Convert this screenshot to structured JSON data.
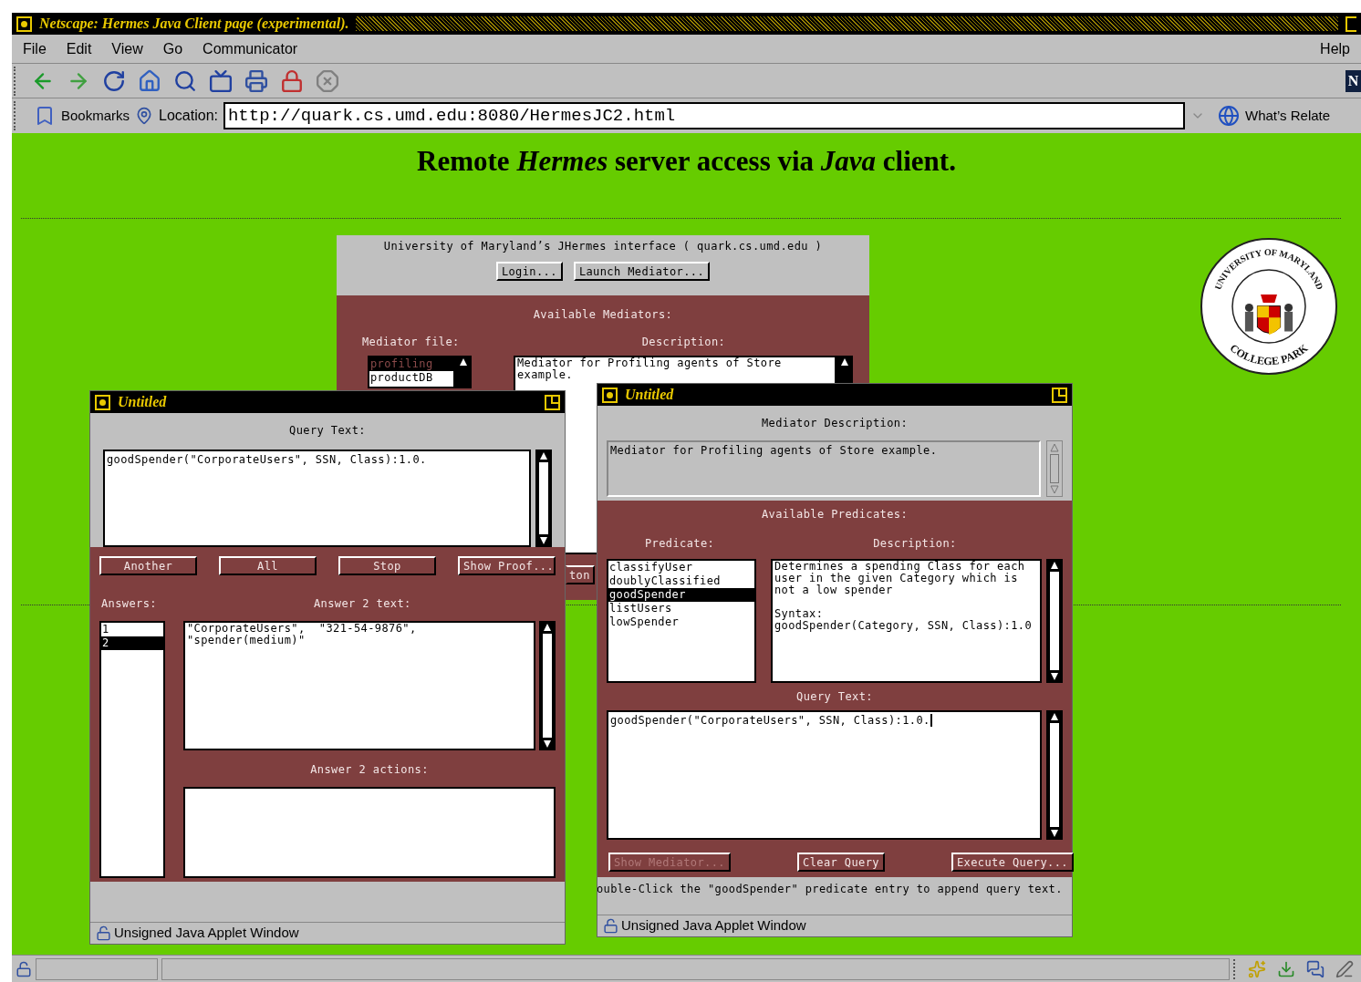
{
  "window": {
    "title": "Netscape: Hermes Java Client page (experimental)."
  },
  "menu": {
    "items": [
      "File",
      "Edit",
      "View",
      "Go",
      "Communicator"
    ],
    "help": "Help"
  },
  "location_bar": {
    "bookmarks": "Bookmarks",
    "label": "Location:",
    "url": "http://quark.cs.umd.edu:8080/HermesJC2.html",
    "whats_related": "What’s Relate"
  },
  "logo_letter": "N",
  "page": {
    "heading": "Remote *Hermes* server access via *Java* client.",
    "seal": {
      "top": "UNIVERSITY OF MARYLAND",
      "bottom": "COLLEGE PARK"
    },
    "applet": {
      "header": "University of Maryland’s JHermes interface ( quark.cs.umd.edu )",
      "buttons": [
        "Login...",
        "Launch Mediator..."
      ],
      "section": "Available Mediators:",
      "file_label": "Mediator file:",
      "description_label": "Description:",
      "files": [
        {
          "label": "profiling",
          "selected": true
        },
        {
          "label": "productDB",
          "selected": false
        }
      ],
      "description": "Mediator for Profiling agents of Store\nexample.",
      "partial_button": "ton"
    },
    "query_window": {
      "title": "Untitled",
      "query_label": "Query Text:",
      "query_text": "goodSpender(\"CorporateUsers\", SSN, Class):1.0.",
      "buttons": [
        "Another",
        "All",
        "Stop",
        "Show Proof..."
      ],
      "answers_label": "Answers:",
      "answer_text_label": "Answer 2 text:",
      "answers": [
        {
          "label": "1",
          "selected": false
        },
        {
          "label": "2",
          "selected": true
        }
      ],
      "answer_text": "\"CorporateUsers\",  \"321-54-9876\",\n\"spender(medium)\"",
      "actions_label": "Answer 2 actions:",
      "status": "Unsigned Java Applet Window"
    },
    "mediator_window": {
      "title": "Untitled",
      "description_label": "Mediator Description:",
      "description": "Mediator for Profiling agents of Store example.",
      "section": "Available Predicates:",
      "predicate_label": "Predicate:",
      "predicate_description_label": "Description:",
      "predicates": [
        {
          "label": "classifyUser",
          "selected": false
        },
        {
          "label": "doublyClassified",
          "selected": false
        },
        {
          "label": "goodSpender",
          "selected": true
        },
        {
          "label": "listUsers",
          "selected": false
        },
        {
          "label": "lowSpender",
          "selected": false
        }
      ],
      "predicate_description": "Determines a spending Class for each\nuser in the given Category which is\nnot a low spender\n\nSyntax:\ngoodSpender(Category, SSN, Class):1.0",
      "query_label": "Query Text:",
      "query_text": "goodSpender(\"CorporateUsers\", SSN, Class):1.0.",
      "buttons": [
        {
          "label": "Show Mediator...",
          "disabled": true
        },
        {
          "label": "Clear Query",
          "disabled": false
        },
        {
          "label": "Execute Query...",
          "disabled": false
        }
      ],
      "hint": "ouble-Click the \"goodSpender\" predicate entry to append query text.",
      "status": "Unsigned Java Applet Window"
    }
  }
}
